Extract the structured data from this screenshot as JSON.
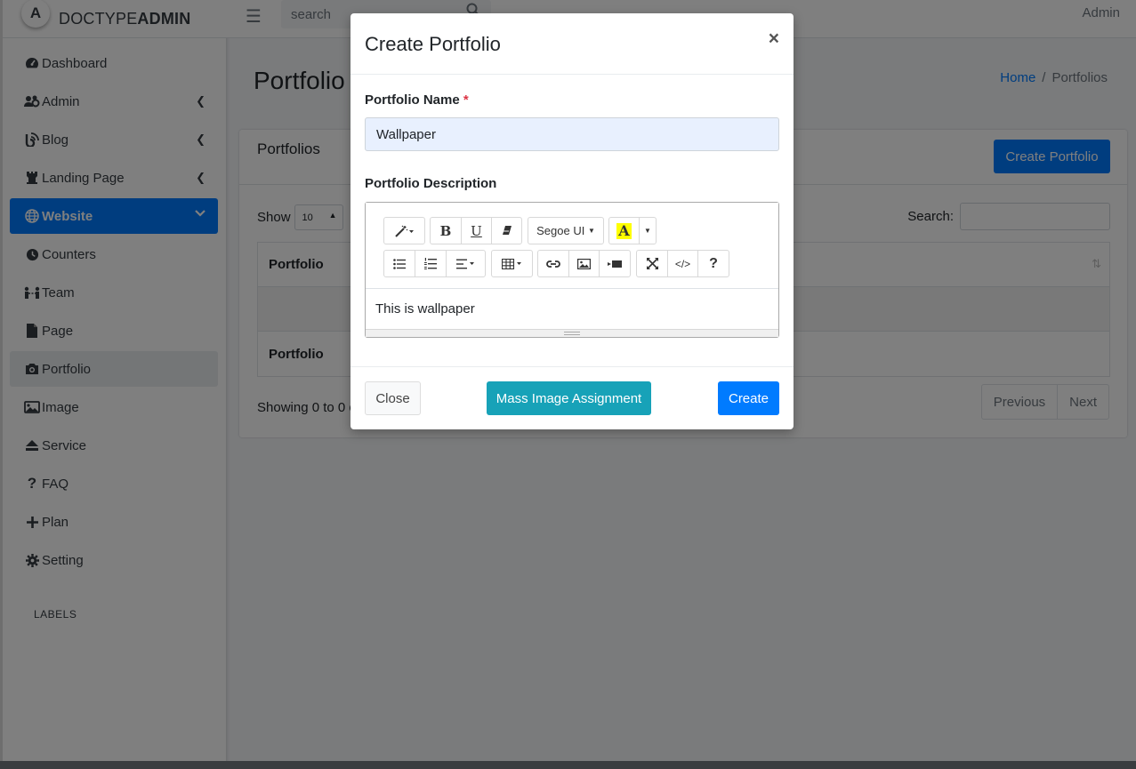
{
  "brand": {
    "logo_letter": "A",
    "name_bold": "DOCTYPE",
    "name_rest": "ADMIN"
  },
  "topnav": {
    "search_placeholder": "search",
    "user": "Admin"
  },
  "sidebar": {
    "items": [
      {
        "label": "Dashboard",
        "icon": "tachometer-icon"
      },
      {
        "label": "Admin",
        "icon": "users-cog-icon",
        "chevron": "<"
      },
      {
        "label": "Blog",
        "icon": "blog-icon",
        "chevron": "<"
      },
      {
        "label": "Landing Page",
        "icon": "chess-rook-icon",
        "chevron": "<"
      },
      {
        "label": "Website",
        "icon": "globe-icon",
        "chevron": "⌄",
        "active": true
      },
      {
        "label": "Counters",
        "icon": "clock-icon"
      },
      {
        "label": "Team",
        "icon": "team-icon"
      },
      {
        "label": "Page",
        "icon": "file-icon"
      },
      {
        "label": "Portfolio",
        "icon": "camera-icon",
        "selected": true
      },
      {
        "label": "Image",
        "icon": "image-icon"
      },
      {
        "label": "Service",
        "icon": "eject-icon"
      },
      {
        "label": "FAQ",
        "icon": "question-icon"
      },
      {
        "label": "Plan",
        "icon": "plus-icon"
      },
      {
        "label": "Setting",
        "icon": "gear-icon"
      }
    ],
    "section_label": "LABELS"
  },
  "content": {
    "page_title": "Portfolio",
    "breadcrumb": {
      "home": "Home",
      "separator": "/",
      "current": "Portfolios"
    },
    "card": {
      "title": "Portfolios",
      "create_button": "Create Portfolio",
      "show_label": "Show",
      "show_value": "10",
      "search_label": "Search:",
      "column_header": "Portfolio",
      "column_footer": "Portfolio",
      "info": "Showing 0 to 0 o",
      "pagination": {
        "previous": "Previous",
        "next": "Next"
      }
    }
  },
  "modal": {
    "title": "Create Portfolio",
    "close_symbol": "×",
    "name_label": "Portfolio Name",
    "required_mark": "*",
    "name_value": "Wallpaper",
    "description_label": "Portfolio Description",
    "editor": {
      "font_name": "Segoe UI",
      "content": "This is wallpaper"
    },
    "buttons": {
      "close": "Close",
      "mass_image": "Mass Image Assignment",
      "create": "Create"
    }
  },
  "colors": {
    "primary": "#007bff",
    "info": "#17a2b8",
    "danger": "#dc3545",
    "overlay": "rgba(0,0,0,0.5)"
  }
}
